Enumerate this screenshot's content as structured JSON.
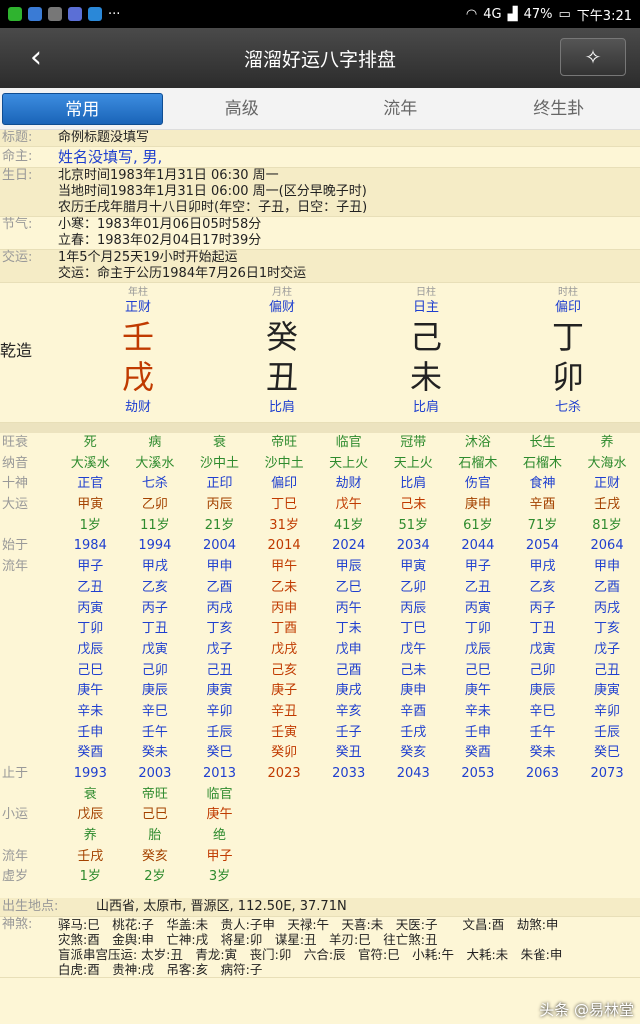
{
  "status": {
    "battery": "47%",
    "time": "下午3:21",
    "network": "4G"
  },
  "app": {
    "title": "溜溜好运八字排盘"
  },
  "tabs": [
    "常用",
    "高级",
    "流年",
    "终生卦"
  ],
  "info": {
    "title_label": "标题:",
    "title_value": "命例标题没填写",
    "owner_label": "命主:",
    "owner_value": "姓名没填写, 男,",
    "birth_label": "生日:",
    "birth_lines": [
      "北京时间1983年1月31日 06:30 周一",
      "当地时间1983年1月31日 06:00 周一(区分早晚子时)",
      "农历壬戌年腊月十八日卯时(年空：子丑，日空：子丑)"
    ],
    "jieqi_label": "节气:",
    "jieqi_lines": [
      "小寒：1983年01月06日05时58分",
      "立春：1983年02月04日17时39分"
    ],
    "jiaoyun_label": "交运:",
    "jiaoyun_lines": [
      "1年5个月25天19小时开始起运",
      "交运：命主于公历1984年7月26日1时交运"
    ]
  },
  "qianzao": {
    "label": "乾造",
    "pillars": [
      {
        "head": "年柱",
        "god": "正财",
        "stem": "壬",
        "branch": "戌",
        "sub": "劫财",
        "color": "#c03a00"
      },
      {
        "head": "月柱",
        "god": "偏财",
        "stem": "癸",
        "branch": "丑",
        "sub": "比肩",
        "color": "#222222"
      },
      {
        "head": "日柱",
        "god": "日主",
        "stem": "己",
        "branch": "未",
        "sub": "比肩",
        "color": "#222222"
      },
      {
        "head": "时柱",
        "god": "偏印",
        "stem": "丁",
        "branch": "卯",
        "sub": "七杀",
        "color": "#222222"
      }
    ]
  },
  "grid": {
    "wangshuai": {
      "label": "旺衰",
      "cells": [
        "死",
        "病",
        "衰",
        "帝旺",
        "临官",
        "冠带",
        "沐浴",
        "长生",
        "养"
      ]
    },
    "nayin": {
      "label": "纳音",
      "cells": [
        "大溪水",
        "大溪水",
        "沙中土",
        "沙中土",
        "天上火",
        "天上火",
        "石榴木",
        "石榴木",
        "大海水"
      ]
    },
    "shishen": {
      "label": "十神",
      "cells": [
        "正官",
        "七杀",
        "正印",
        "偏印",
        "劫财",
        "比肩",
        "伤官",
        "食神",
        "正财"
      ]
    },
    "dayun": {
      "label": "大运",
      "cells": [
        "甲寅",
        "乙卯",
        "丙辰",
        "丁巳",
        "戊午",
        "己未",
        "庚申",
        "辛酉",
        "壬戌"
      ]
    },
    "age": {
      "label": "",
      "cells": [
        "1岁",
        "11岁",
        "21岁",
        "31岁",
        "41岁",
        "51岁",
        "61岁",
        "71岁",
        "81岁"
      ]
    },
    "shiyu": {
      "label": "始于",
      "cells": [
        "1984",
        "1994",
        "2004",
        "2014",
        "2024",
        "2034",
        "2044",
        "2054",
        "2064"
      ]
    },
    "liunian_label": "流年",
    "liunian": [
      [
        "甲子",
        "甲戌",
        "甲申",
        "甲午",
        "甲辰",
        "甲寅",
        "甲子",
        "甲戌",
        "甲申"
      ],
      [
        "乙丑",
        "乙亥",
        "乙酉",
        "乙未",
        "乙巳",
        "乙卯",
        "乙丑",
        "乙亥",
        "乙酉"
      ],
      [
        "丙寅",
        "丙子",
        "丙戌",
        "丙申",
        "丙午",
        "丙辰",
        "丙寅",
        "丙子",
        "丙戌"
      ],
      [
        "丁卯",
        "丁丑",
        "丁亥",
        "丁酉",
        "丁未",
        "丁巳",
        "丁卯",
        "丁丑",
        "丁亥"
      ],
      [
        "戊辰",
        "戊寅",
        "戊子",
        "戊戌",
        "戊申",
        "戊午",
        "戊辰",
        "戊寅",
        "戊子"
      ],
      [
        "己巳",
        "己卯",
        "己丑",
        "己亥",
        "己酉",
        "己未",
        "己巳",
        "己卯",
        "己丑"
      ],
      [
        "庚午",
        "庚辰",
        "庚寅",
        "庚子",
        "庚戌",
        "庚申",
        "庚午",
        "庚辰",
        "庚寅"
      ],
      [
        "辛未",
        "辛巳",
        "辛卯",
        "辛丑",
        "辛亥",
        "辛酉",
        "辛未",
        "辛巳",
        "辛卯"
      ],
      [
        "壬申",
        "壬午",
        "壬辰",
        "壬寅",
        "壬子",
        "壬戌",
        "壬申",
        "壬午",
        "壬辰"
      ],
      [
        "癸酉",
        "癸未",
        "癸巳",
        "癸卯",
        "癸丑",
        "癸亥",
        "癸酉",
        "癸未",
        "癸巳"
      ]
    ],
    "zhiyu": {
      "label": "止于",
      "cells": [
        "1993",
        "2003",
        "2013",
        "2023",
        "2033",
        "2043",
        "2053",
        "2063",
        "2073"
      ]
    },
    "xiaoyun_top": [
      "衰",
      "帝旺",
      "临官"
    ],
    "xiaoyun": {
      "label": "小运",
      "cells": [
        "戊辰",
        "己巳",
        "庚午"
      ]
    },
    "xiaoyun_bot": [
      "养",
      "胎",
      "绝"
    ],
    "liunian2": {
      "label": "流年",
      "cells": [
        "壬戌",
        "癸亥",
        "甲子"
      ]
    },
    "xusui": {
      "label": "虚岁",
      "cells": [
        "1岁",
        "2岁",
        "3岁"
      ]
    }
  },
  "bottom": {
    "birthplace_label": "出生地点:",
    "birthplace_value": "山西省, 太原市, 晋源区, 112.50E, 37.71N",
    "shensha_label": "神煞:",
    "shensha_lines": [
      "驿马:巳　桃花:子　华盖:未　贵人:子申　天禄:午　天喜:未　天医:子　　文昌:酉　劫煞:申",
      "灾煞:酉　金舆:申　亡神:戌　将星:卯　谋星:丑　羊刃:巳　往亡煞:丑",
      "盲派串宫压运: 太岁:丑　青龙:寅　丧门:卯　六合:辰　官符:巳　小耗:午　大耗:未　朱雀:申",
      "白虎:酉　贵神:戌　吊客:亥　病符:子"
    ]
  },
  "watermark": "头条 @易林堂"
}
